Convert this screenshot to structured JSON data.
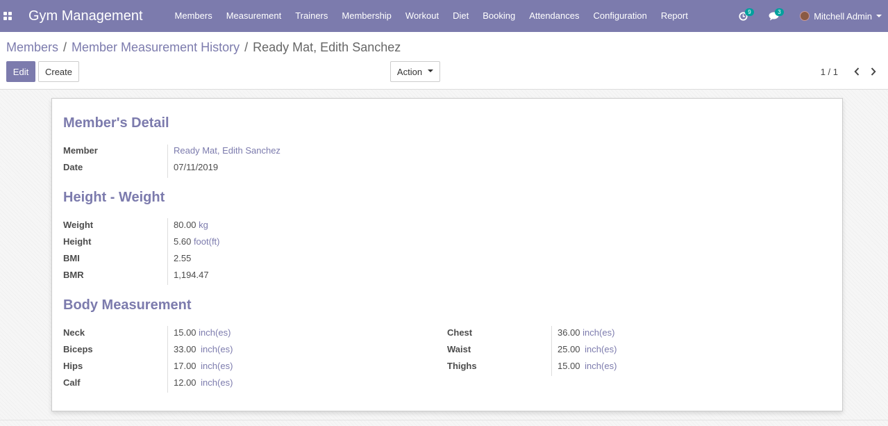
{
  "navbar": {
    "app_title": "Gym Management",
    "menu": [
      "Members",
      "Measurement",
      "Trainers",
      "Membership",
      "Workout",
      "Diet",
      "Booking",
      "Attendances",
      "Configuration",
      "Report"
    ],
    "activity_count": "9",
    "message_count": "3",
    "user_name": "Mitchell Admin"
  },
  "breadcrumb": {
    "items": [
      "Members",
      "Member Measurement History"
    ],
    "current": "Ready Mat, Edith Sanchez"
  },
  "toolbar": {
    "edit_label": "Edit",
    "create_label": "Create",
    "action_label": "Action"
  },
  "pager": {
    "value": "1 / 1"
  },
  "form": {
    "members_detail": {
      "title": "Member's Detail",
      "member_label": "Member",
      "member_value": "Ready Mat, Edith Sanchez",
      "date_label": "Date",
      "date_value": "07/11/2019"
    },
    "height_weight": {
      "title": "Height - Weight",
      "weight_label": "Weight",
      "weight_value": "80.00",
      "weight_unit": "kg",
      "height_label": "Height",
      "height_value": "5.60",
      "height_unit": "foot(ft)",
      "bmi_label": "BMI",
      "bmi_value": "2.55",
      "bmr_label": "BMR",
      "bmr_value": "1,194.47"
    },
    "body_measurement": {
      "title": "Body Measurement",
      "neck_label": "Neck",
      "neck_value": "15.00",
      "neck_unit": "inch(es)",
      "biceps_label": "Biceps",
      "biceps_value": "33.00",
      "biceps_unit": "inch(es)",
      "hips_label": "Hips",
      "hips_value": "17.00",
      "hips_unit": "inch(es)",
      "calf_label": "Calf",
      "calf_value": "12.00",
      "calf_unit": "inch(es)",
      "chest_label": "Chest",
      "chest_value": "36.00",
      "chest_unit": "inch(es)",
      "waist_label": "Waist",
      "waist_value": "25.00",
      "waist_unit": "inch(es)",
      "thighs_label": "Thighs",
      "thighs_value": "15.00",
      "thighs_unit": "inch(es)"
    }
  },
  "colors": {
    "navbar": "#7c7bad",
    "accent": "#7c7bad",
    "badge": "#00a09d"
  },
  "icons": [
    "apps-icon",
    "activity-icon",
    "messages-icon",
    "avatar",
    "chevron-left-icon",
    "chevron-right-icon"
  ]
}
